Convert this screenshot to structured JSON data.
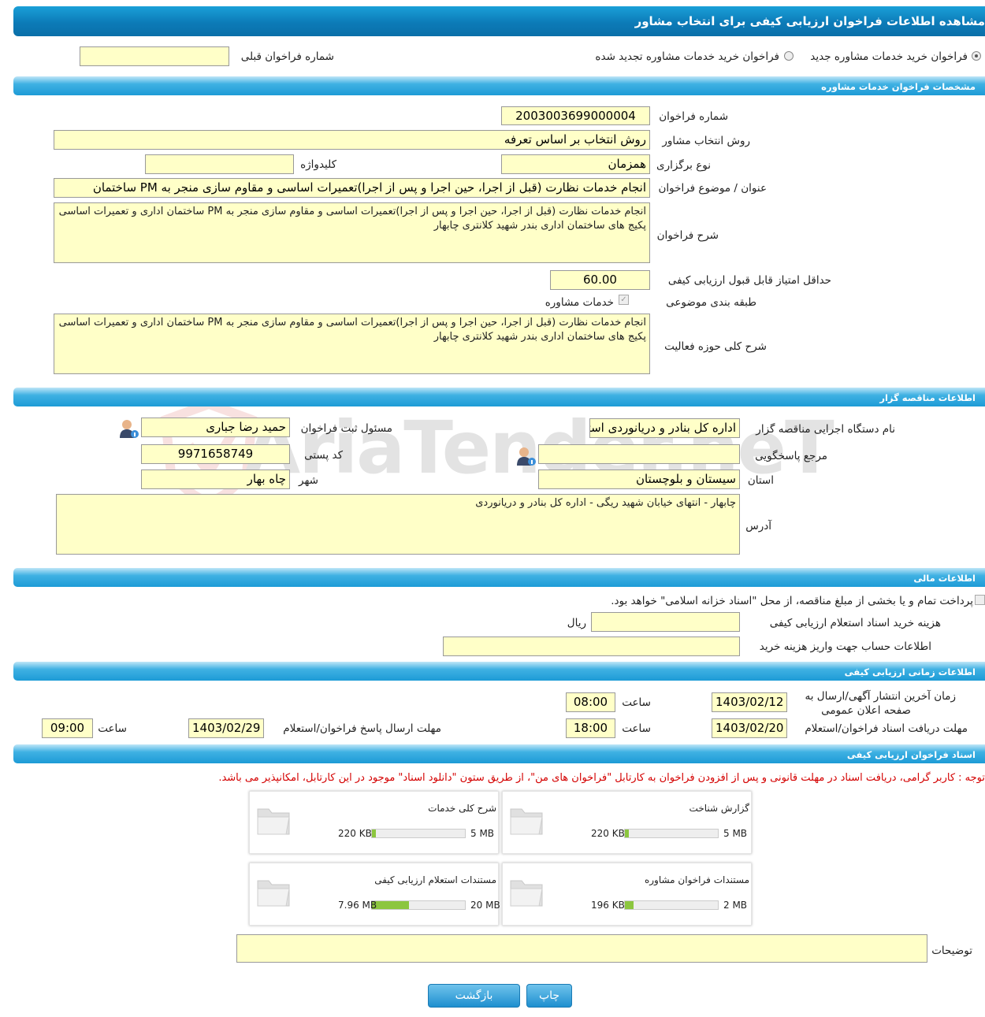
{
  "header": {
    "title": "مشاهده اطلاعات فراخوان ارزیابی کیفی برای انتخاب مشاور"
  },
  "top_options": {
    "radio_new": "فراخوان خرید خدمات مشاوره جدید",
    "radio_renewed": "فراخوان خرید خدمات مشاوره تجدید شده",
    "prev_number_label": "شماره فراخوان قبلی",
    "prev_number_value": ""
  },
  "sections": {
    "call_specs": "مشخصات فراخوان خدمات مشاوره",
    "tenderer_info": "اطلاعات مناقصه گزار",
    "financial_info": "اطلاعات مالی",
    "timing_info": "اطلاعات زمانی ارزیابی کیفی",
    "documents": "اسناد فراخوان ارزیابی کیفی"
  },
  "specs": {
    "call_number_label": "شماره فراخوان",
    "call_number_value": "2003003699000004",
    "selection_method_label": "روش انتخاب مشاور",
    "selection_method_value": "روش انتخاب بر اساس تعرفه",
    "holding_type_label": "نوع برگزاری",
    "holding_type_value": "همزمان",
    "keyword_label": "کلیدواژه",
    "keyword_value": "",
    "subject_label": "عنوان / موضوع فراخوان",
    "subject_value": "انجام خدمات نظارت (قبل از اجرا، حین اجرا و پس از اجرا)تعمیرات اساسی و مقاوم سازی منجر به PM ساختمان",
    "description_label": "شرح فراخوان",
    "description_value": "انجام خدمات نظارت (قبل از اجرا، حین اجرا و پس از اجرا)تعمیرات اساسی و مقاوم سازی منجر به PM ساختمان اداری و تعمیرات اساسی پکیج های ساختمان اداری بندر شهید کلانتری چابهار",
    "min_score_label": "حداقل امتیاز قابل قبول ارزیابی کیفی",
    "min_score_value": "60.00",
    "category_label": "طبقه بندی موضوعی",
    "category_value": "خدمات مشاوره",
    "activity_label": "شرح کلی حوزه فعالیت",
    "activity_value": "انجام خدمات نظارت (قبل از اجرا، حین اجرا و پس از اجرا)تعمیرات اساسی و مقاوم سازی منجر به PM ساختمان اداری و تعمیرات اساسی پکیج های ساختمان اداری بندر شهید کلانتری چابهار"
  },
  "tenderer": {
    "org_label": "نام دستگاه اجرایی مناقصه گزار",
    "org_value": "اداره کل بنادر و دریانوردی استان سیستان و بلوچستان",
    "registrar_label": "مسئول ثبت فراخوان",
    "registrar_value": "حمید رضا جباری",
    "reference_label": "مرجع پاسخگویی",
    "reference_value": "",
    "postal_label": "کد پستی",
    "postal_value": "9971658749",
    "province_label": "استان",
    "province_value": "سیستان و بلوچستان",
    "city_label": "شهر",
    "city_value": "چاه بهار",
    "address_label": "آدرس",
    "address_value": "چابهار - انتهای خیابان شهید ریگی - اداره کل بنادر و دریانوردی"
  },
  "financial": {
    "treasury_text": "پرداخت تمام و یا بخشی از مبلغ مناقصه، از محل \"اسناد خزانه اسلامی\" خواهد بود.",
    "cost_label": "هزینه خرید اسناد استعلام ارزیابی کیفی",
    "cost_value": "",
    "currency": "ریال",
    "account_label": "اطلاعات حساب جهت واریز هزینه خرید",
    "account_value": ""
  },
  "timing": {
    "publish_label_1": "زمان آخرین انتشار آگهی/ارسال به",
    "publish_label_2": "صفحه اعلان عمومی",
    "publish_date": "1403/02/12",
    "publish_time": "08:00",
    "hour_label": "ساعت",
    "receive_label": "مهلت دریافت اسناد فراخوان/استعلام",
    "receive_date": "1403/02/20",
    "receive_time": "18:00",
    "submit_label": "مهلت ارسال پاسخ فراخوان/استعلام",
    "submit_date": "1403/02/29",
    "submit_time": "09:00"
  },
  "documents": {
    "notice": "توجه : کاربر گرامی، دریافت اسناد در مهلت قانونی و پس از افزودن فراخوان به کارتابل \"فراخوان های من\"، از طریق ستون \"دانلود اسناد\" موجود در این کارتابل، امکانپذیر می باشد.",
    "files": [
      {
        "title": "گزارش شناخت",
        "current": "220 KB",
        "max": "5 MB",
        "fraction": 0.043
      },
      {
        "title": "شرح کلی خدمات",
        "current": "220 KB",
        "max": "5 MB",
        "fraction": 0.043
      },
      {
        "title": "مستندات فراخوان مشاوره",
        "current": "196 KB",
        "max": "2 MB",
        "fraction": 0.096
      },
      {
        "title": "مستندات استعلام ارزیابی کیفی",
        "current": "7.96 MB",
        "max": "20 MB",
        "fraction": 0.398
      }
    ],
    "notes_label": "توضیحات",
    "notes_value": ""
  },
  "buttons": {
    "print": "چاپ",
    "back": "بازگشت"
  },
  "watermark": "AriaTender.neT",
  "colors": {
    "header_blue": "#0c7bb8",
    "field_yellow": "#ffffc8",
    "warning_red": "#d40000",
    "progress_green": "#8cc63f"
  }
}
